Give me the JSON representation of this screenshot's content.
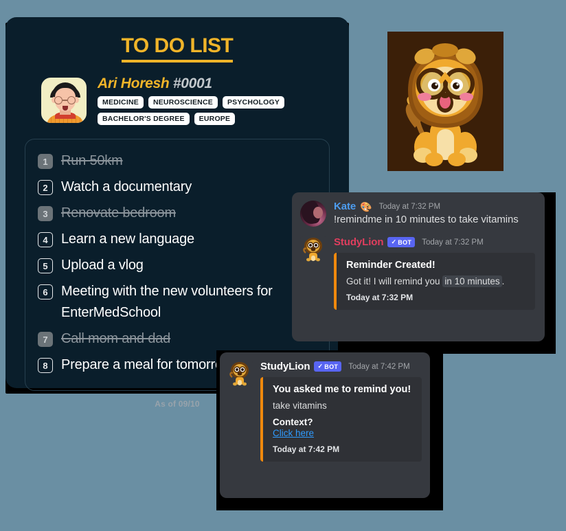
{
  "colors": {
    "background": "#6a8fa3",
    "card_bg": "#0a1e2b",
    "accent_yellow": "#f0b429",
    "discord_bg": "#36393f",
    "embed_bg": "#2f3136",
    "embed_accent": "#f0890d",
    "bot_badge": "#5865f2",
    "link_blue": "#2f9bff"
  },
  "todo": {
    "title": "TO DO LIST",
    "profile": {
      "name": "Ari Horesh",
      "id": "#0001",
      "avatar_icon": "person-avatar-icon",
      "tags_row1": [
        "MEDICINE",
        "NEUROSCIENCE",
        "PSYCHOLOGY"
      ],
      "tags_row2": [
        "BACHELOR'S DEGREE",
        "EUROPE"
      ]
    },
    "tasks": [
      {
        "num": "1",
        "text": "Run 50km",
        "done": true
      },
      {
        "num": "2",
        "text": "Watch a documentary",
        "done": false
      },
      {
        "num": "3",
        "text": "Renovate bedroom",
        "done": true
      },
      {
        "num": "4",
        "text": "Learn a new language",
        "done": false
      },
      {
        "num": "5",
        "text": "Upload a vlog",
        "done": false
      },
      {
        "num": "6",
        "text": "Meeting with the new volunteers for EnterMedSchool",
        "done": false
      },
      {
        "num": "7",
        "text": "Call mom and dad",
        "done": true
      },
      {
        "num": "8",
        "text": "Prepare a meal for tomorrow",
        "done": false
      }
    ],
    "footer": "As of 09/10"
  },
  "mascot": {
    "icon": "studylion-mascot-icon",
    "alt": "StudyLion cartoon lion with glasses"
  },
  "chat1": {
    "messages": [
      {
        "author": "Kate",
        "author_color": "#4d9df0",
        "emoji": "palette-emoji",
        "emoji_glyph": "🎨",
        "is_bot": false,
        "timestamp": "Today at 7:32 PM",
        "text": "!remindme in 10 minutes to take vitamins",
        "avatar_icon": "kate-avatar-icon"
      },
      {
        "author": "StudyLion",
        "author_color": "#e03e5e",
        "is_bot": true,
        "bot_label": "BOT",
        "bot_check": "✓",
        "timestamp": "Today at 7:32 PM",
        "avatar_icon": "studylion-avatar-icon",
        "embed": {
          "title": "Reminder Created!",
          "desc_before": "Got it! I will remind you",
          "desc_code": "in 10 minutes",
          "desc_after": ".",
          "footer": "Today at 7:32 PM"
        }
      }
    ]
  },
  "chat2": {
    "message": {
      "author": "StudyLion",
      "author_color": "#ffffff",
      "is_bot": true,
      "bot_label": "BOT",
      "bot_check": "✓",
      "timestamp": "Today at 7:42 PM",
      "avatar_icon": "studylion-avatar-icon",
      "embed": {
        "title": "You asked me to remind you!",
        "desc": "take vitamins",
        "sub": "Context?",
        "link": "Click here",
        "footer": "Today at 7:42 PM"
      }
    }
  }
}
